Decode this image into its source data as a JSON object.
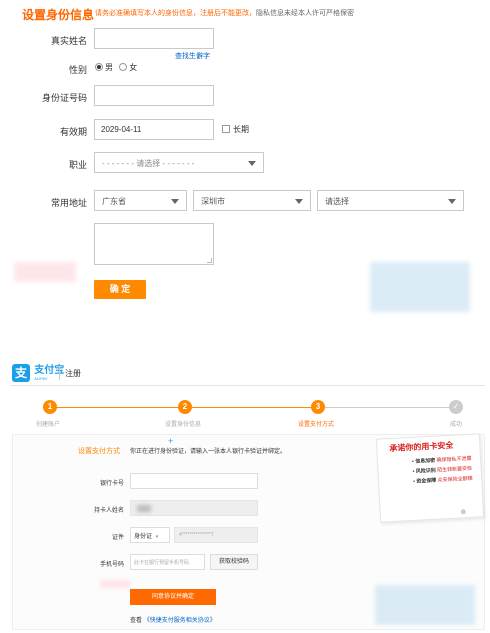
{
  "top_form": {
    "title": "设置身份信息",
    "notice": "请务必准确填写本人的身份信息，注册后不能更改，",
    "privacy": "隐私信息未经本人许可严格保密",
    "fields": {
      "name_label": "真实姓名",
      "rare_char_link": "查找生僻字",
      "gender_label": "性别",
      "male": "男",
      "female": "女",
      "id_label": "身份证号码",
      "validity_label": "有效期",
      "validity_value": "2029-04-11",
      "long_term": "长期",
      "job_label": "职业",
      "job_placeholder": "- - - - - - - 请选择 - - - - - - -",
      "address_label": "常用地址",
      "province": "广东省",
      "city": "深圳市",
      "district": "请选择"
    },
    "submit_label": "确 定"
  },
  "alipay": {
    "logo_text": "支付宝",
    "logo_sub": "ALIPAY",
    "page_label": "注册",
    "steps": [
      {
        "num": "1",
        "label": "创建账户"
      },
      {
        "num": "2",
        "label": "设置身份信息"
      },
      {
        "num": "3",
        "label": "设置支付方式"
      },
      {
        "num": "✓",
        "label": "成功"
      }
    ],
    "form": {
      "section_title": "设置支付方式",
      "description": "你正在进行身份验证，请输入一张本人银行卡验证并绑定。",
      "card_label": "银行卡号",
      "holder_label": "持卡人姓名",
      "id_type_label": "证件",
      "id_type_value": "身份证",
      "id_masked": "4***************7",
      "phone_label": "手机号码",
      "phone_placeholder": "此卡在银行预留手机号码",
      "get_code_label": "获取校验码",
      "agree_button": "同意协议并确定",
      "view_prefix": "查看",
      "agreement_link": "《快捷支付服务相关协议》"
    },
    "promo": {
      "heading": "承诺你的用卡安全",
      "items": [
        {
          "title": "• 信息加密",
          "desc": "确保隐私不泄露"
        },
        {
          "title": "• 风险识别",
          "desc": "陌生转账要安检"
        },
        {
          "title": "• 资金保障",
          "desc": "众安保险全额赔"
        }
      ]
    }
  },
  "colors": {
    "orange": "#ff6600",
    "accent": "#ff8a00",
    "link": "#0066cc",
    "alipay_blue": "#1aa0e8"
  }
}
